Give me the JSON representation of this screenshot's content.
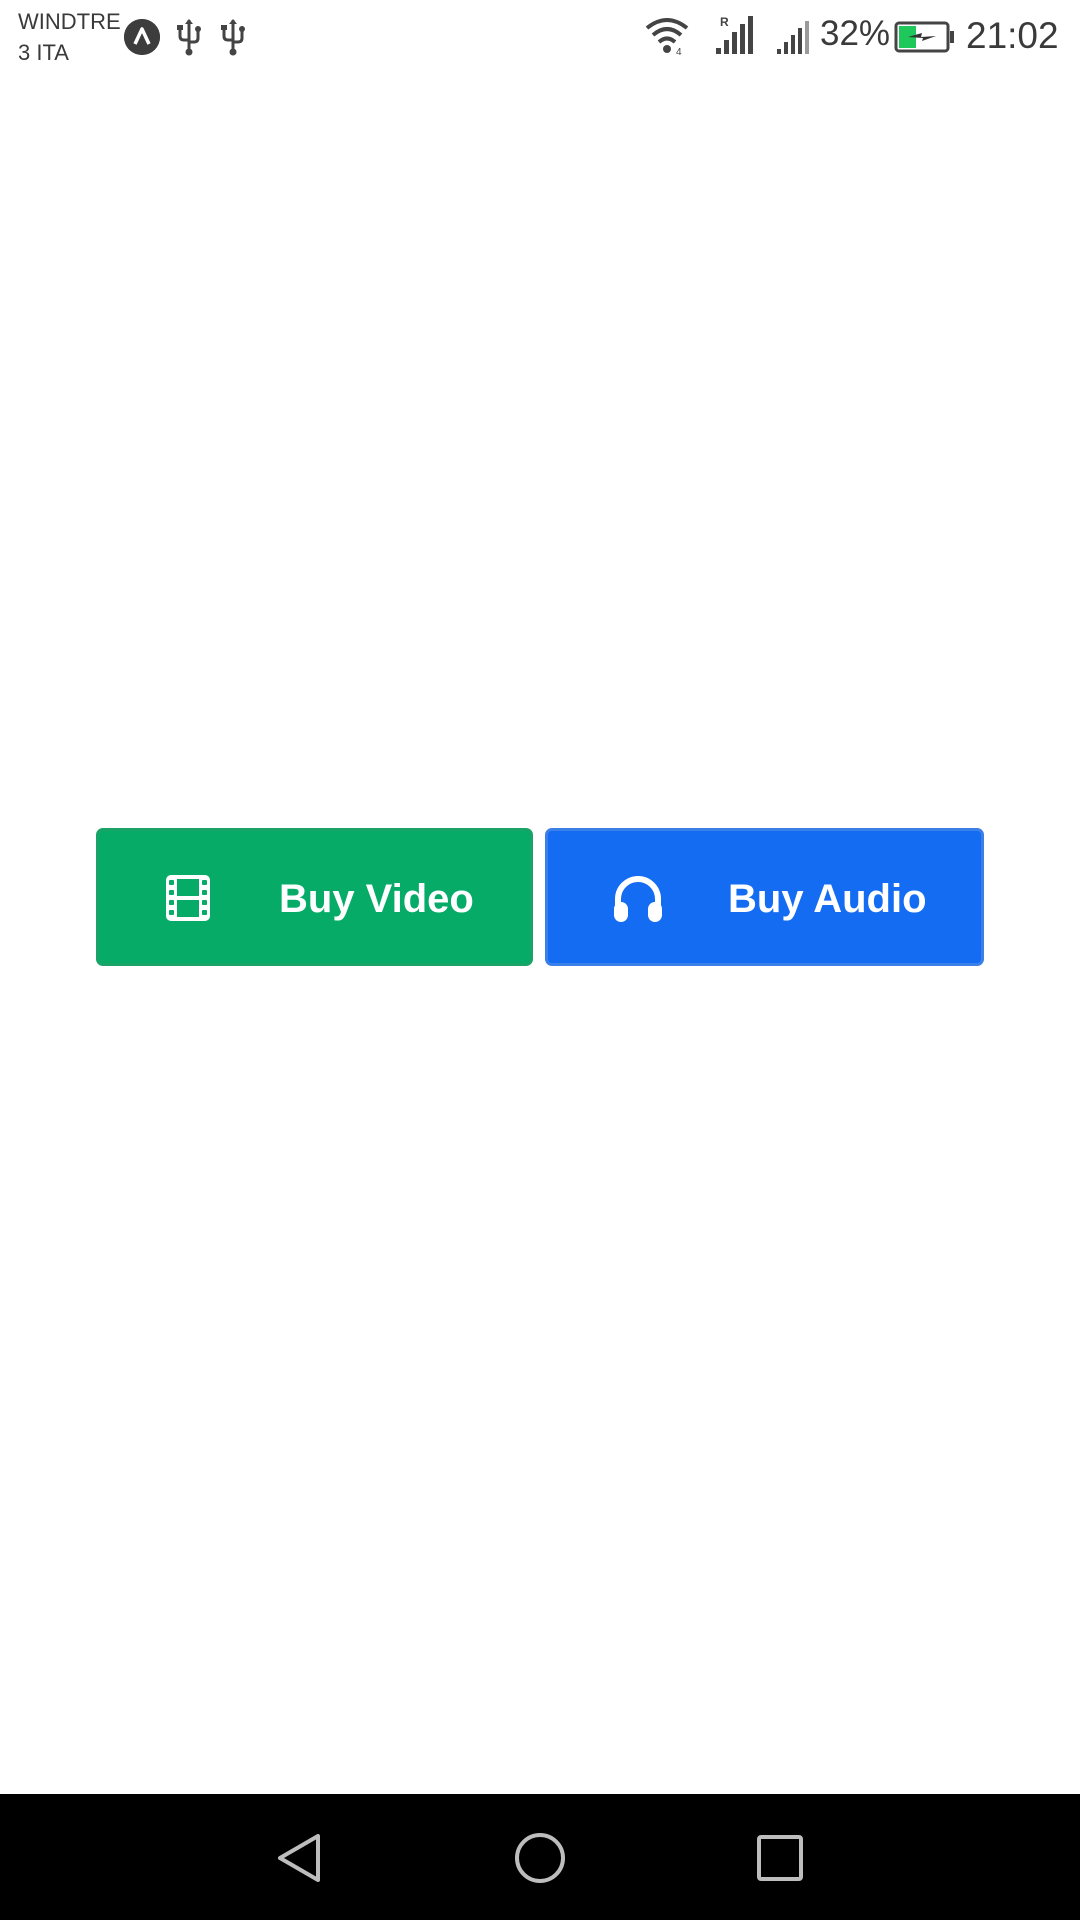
{
  "status_bar": {
    "carrier_line1": "WINDTRE",
    "carrier_line2": "3 ITA",
    "battery_percent": "32%",
    "time": "21:02",
    "icons": [
      "app-badge-icon",
      "usb-icon",
      "usb-icon",
      "wifi-icon",
      "signal-roaming-icon",
      "signal-icon",
      "battery-charging-icon"
    ]
  },
  "buttons": {
    "video": {
      "label": "Buy Video",
      "icon": "film-icon",
      "color": "#06ab68"
    },
    "audio": {
      "label": "Buy Audio",
      "icon": "headphones-icon",
      "color": "#146cf2"
    }
  },
  "nav_bar": {
    "icons": [
      "back-icon",
      "home-icon",
      "recents-icon"
    ]
  }
}
